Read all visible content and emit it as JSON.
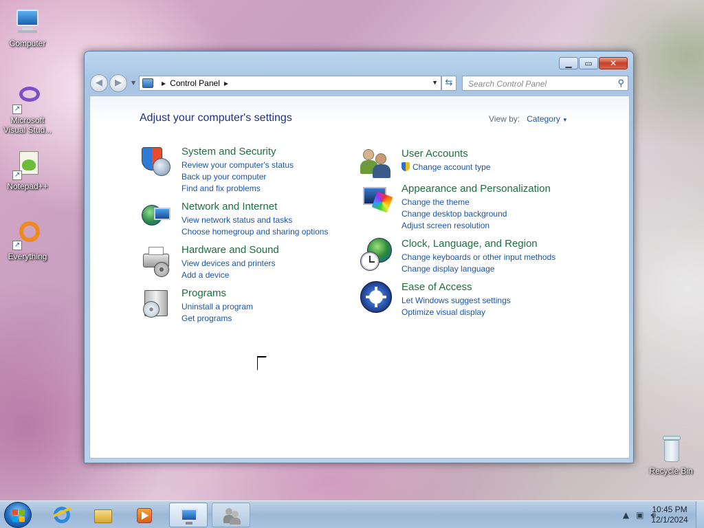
{
  "desktop": {
    "icons": [
      {
        "label": "Computer"
      },
      {
        "label": "Microsoft Visual Stud..."
      },
      {
        "label": "Notepad++"
      },
      {
        "label": "Everything"
      },
      {
        "label": "Recycle Bin"
      }
    ]
  },
  "window": {
    "address": {
      "crumb": "Control Panel"
    },
    "search": {
      "placeholder": "Search Control Panel"
    },
    "heading": "Adjust your computer's settings",
    "view_by": {
      "label": "View by:",
      "value": "Category"
    },
    "categories_left": [
      {
        "title": "System and Security",
        "links": [
          "Review your computer's status",
          "Back up your computer",
          "Find and fix problems"
        ]
      },
      {
        "title": "Network and Internet",
        "links": [
          "View network status and tasks",
          "Choose homegroup and sharing options"
        ]
      },
      {
        "title": "Hardware and Sound",
        "links": [
          "View devices and printers",
          "Add a device"
        ]
      },
      {
        "title": "Programs",
        "links": [
          "Uninstall a program",
          "Get programs"
        ]
      }
    ],
    "categories_right": [
      {
        "title": "User Accounts",
        "links": [
          "Change account type"
        ]
      },
      {
        "title": "Appearance and Personalization",
        "links": [
          "Change the theme",
          "Change desktop background",
          "Adjust screen resolution"
        ]
      },
      {
        "title": "Clock, Language, and Region",
        "links": [
          "Change keyboards or other input methods",
          "Change display language"
        ]
      },
      {
        "title": "Ease of Access",
        "links": [
          "Let Windows suggest settings",
          "Optimize visual display"
        ]
      }
    ]
  },
  "taskbar": {
    "time": "10:45 PM",
    "date": "12/1/2024"
  },
  "colors": {
    "category_title": "#1e6e41",
    "link": "#1a55a8",
    "heading": "#1e3287"
  }
}
